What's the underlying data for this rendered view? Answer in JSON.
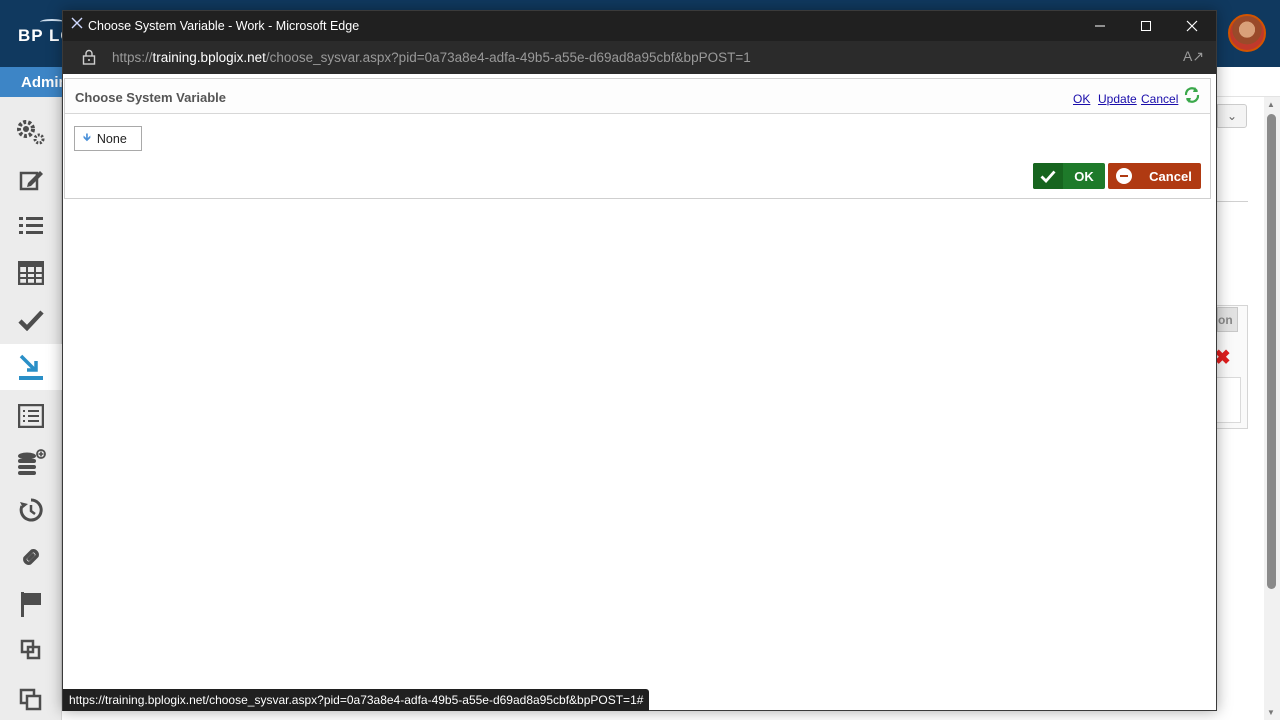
{
  "app": {
    "logo_text": "BP LO",
    "admin_tab": "Admin"
  },
  "sidebar": {
    "items": [
      {
        "name": "settings",
        "icon": "gears-icon"
      },
      {
        "name": "edit",
        "icon": "edit-icon"
      },
      {
        "name": "list",
        "icon": "list-icon"
      },
      {
        "name": "table",
        "icon": "table-icon"
      },
      {
        "name": "check",
        "icon": "check-icon"
      },
      {
        "name": "import",
        "icon": "import-icon",
        "active": true
      },
      {
        "name": "document-list",
        "icon": "document-list-icon"
      },
      {
        "name": "database-add",
        "icon": "database-add-icon"
      },
      {
        "name": "timer",
        "icon": "timer-icon"
      },
      {
        "name": "link",
        "icon": "link-icon"
      },
      {
        "name": "flag",
        "icon": "flag-icon"
      },
      {
        "name": "layers",
        "icon": "layers-icon"
      },
      {
        "name": "copy",
        "icon": "copy-icon"
      }
    ]
  },
  "background": {
    "partial_button": "on"
  },
  "popup": {
    "window_title": "Choose System Variable - Work - Microsoft Edge",
    "url_scheme": "https://",
    "url_domain": "training.bplogix.net",
    "url_path": "/choose_sysvar.aspx?pid=0a73a8e4-adfa-49b5-a55e-d69ad8a95cbf&bpPOST=1",
    "dialog": {
      "title": "Choose System Variable",
      "links": {
        "ok": "OK",
        "update": "Update",
        "cancel": "Cancel"
      },
      "none_button": "None",
      "ok_button": "OK",
      "cancel_button": "Cancel"
    },
    "status_url": "https://training.bplogix.net/choose_sysvar.aspx?pid=0a73a8e4-adfa-49b5-a55e-d69ad8a95cbf&bpPOST=1#"
  },
  "colors": {
    "header_bg": "#10395f",
    "admin_tab": "#3d85c6",
    "ok_green": "#1e7a2a",
    "cancel_red": "#b03a12",
    "active_icon": "#2a8fc7"
  }
}
